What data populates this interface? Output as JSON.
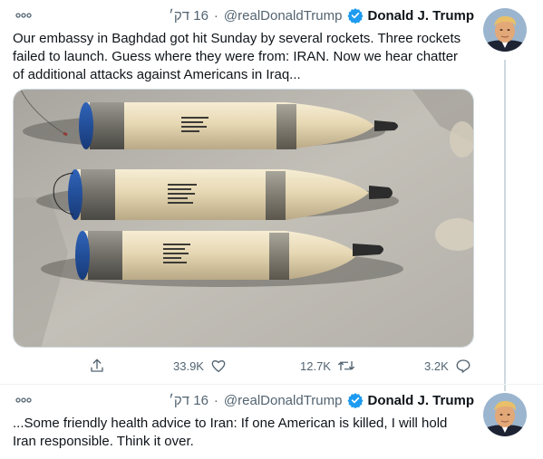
{
  "tweets": [
    {
      "name": "Donald J. Trump",
      "handle": "@realDonaldTrump",
      "time": "16 דק׳",
      "text": "Our embassy in Baghdad got hit Sunday by several rockets. Three rockets failed to launch. Guess where they were from: IRAN. Now we hear chatter of additional attacks against Americans in Iraq...",
      "replies": "3.2K",
      "retweets": "12.7K",
      "likes": "33.9K"
    },
    {
      "name": "Donald J. Trump",
      "handle": "@realDonaldTrump",
      "time": "16 דק׳",
      "text": "...Some friendly health advice to Iran: If one American is killed, I will hold Iran responsible. Think it over."
    }
  ],
  "icons": {
    "more": "more-icon",
    "verified": "verified-badge-icon",
    "share": "share-icon",
    "like": "heart-icon",
    "retweet": "retweet-icon",
    "reply": "reply-icon"
  },
  "colors": {
    "verified": "#1d9bf0",
    "secondary_text": "#536471",
    "thread_line": "#cfd9de"
  }
}
